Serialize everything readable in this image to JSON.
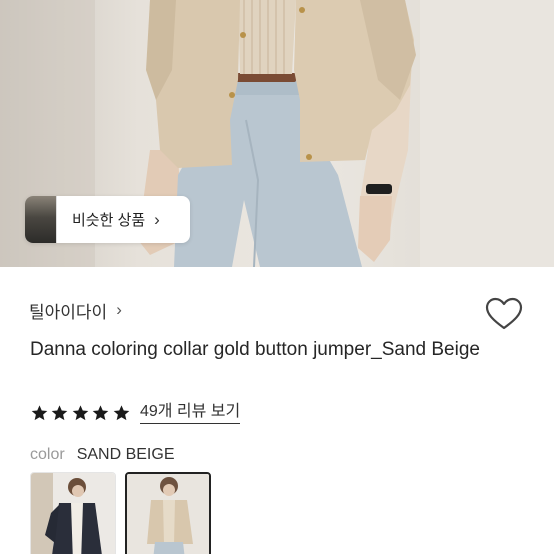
{
  "hero": {
    "similar_button_label": "비슷한 상품",
    "similar_button_icon": "chevron-right-icon"
  },
  "product": {
    "brand": "틸아이다이",
    "title": "Danna coloring collar gold button jumper_Sand Beige",
    "rating": 5,
    "rating_max": 5,
    "review_link": "49개 리뷰 보기",
    "wishlist_icon": "heart-outline-icon",
    "color_label": "color",
    "color_value": "SAND BEIGE",
    "color_options": [
      {
        "name": "navy",
        "selected": false
      },
      {
        "name": "sand-beige",
        "selected": true
      }
    ]
  },
  "colors": {
    "star": "#1a1a1a",
    "text": "#262626",
    "muted": "#9a9a9a",
    "jacket_beige": "#d8c7ad",
    "jeans": "#b8c5cf"
  }
}
